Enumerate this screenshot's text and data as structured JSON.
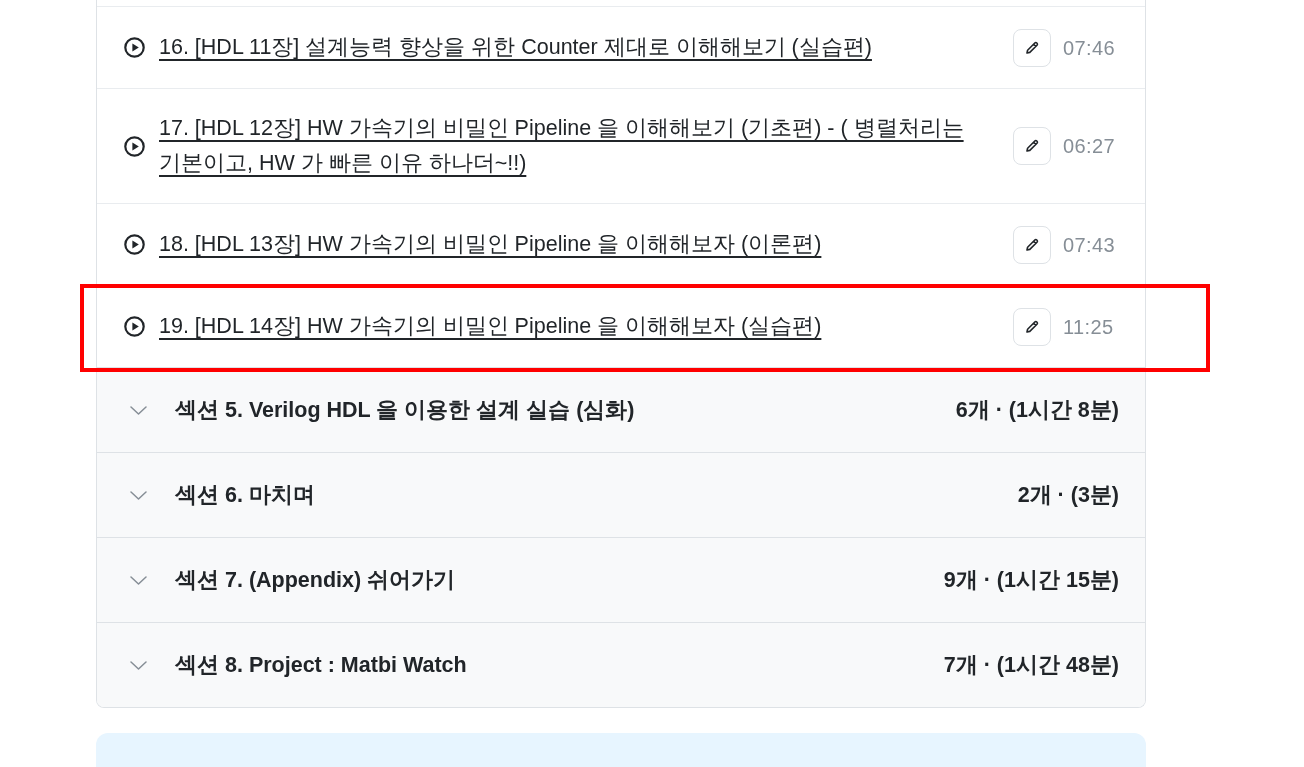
{
  "lessons": [
    {
      "title": "16. [HDL 11장] 설계능력 향상을 위한 Counter 제대로 이해해보기 (실습편)",
      "duration": "07:46",
      "highlighted": false
    },
    {
      "title": "17. [HDL 12장] HW 가속기의 비밀인 Pipeline 을 이해해보기 (기초편) - ( 병렬처리는 기본이고, HW 가 빠른 이유 하나더~!!)",
      "duration": "06:27",
      "highlighted": false
    },
    {
      "title": "18. [HDL 13장] HW 가속기의 비밀인 Pipeline 을 이해해보자 (이론편)",
      "duration": "07:43",
      "highlighted": false
    },
    {
      "title": "19. [HDL 14장] HW 가속기의 비밀인 Pipeline 을 이해해보자 (실습편)",
      "duration": "11:25",
      "highlighted": true
    }
  ],
  "sections": [
    {
      "title": "섹션 5. Verilog HDL 을 이용한 설계 실습 (심화)",
      "summary": "6개 · (1시간 8분)",
      "expanded": false
    },
    {
      "title": "섹션 6. 마치며",
      "summary": "2개 · (3분)",
      "expanded": false
    },
    {
      "title": "섹션 7. (Appendix) 쉬어가기",
      "summary": "9개 · (1시간 15분)",
      "expanded": false
    },
    {
      "title": "섹션 8. Project : Matbi Watch",
      "summary": "7개 · (1시간 48분)",
      "expanded": false
    }
  ]
}
